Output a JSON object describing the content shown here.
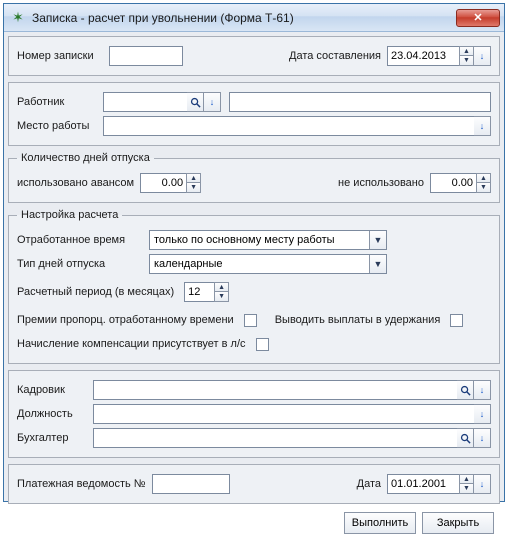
{
  "window": {
    "title": "Записка - расчет при увольнении (Форма Т-61)"
  },
  "top": {
    "note_number_label": "Номер записки",
    "note_number_value": "",
    "date_label": "Дата составления",
    "date_value": "23.04.2013"
  },
  "employee": {
    "worker_label": "Работник",
    "worker_value": "",
    "worker_info": "",
    "workplace_label": "Место работы",
    "workplace_value": ""
  },
  "vacation_days": {
    "legend": "Количество дней отпуска",
    "used_advance_label": "использовано авансом",
    "used_advance_value": "0.00",
    "not_used_label": "не использовано",
    "not_used_value": "0.00"
  },
  "calc": {
    "legend": "Настройка расчета",
    "worked_time_label": "Отработанное время",
    "worked_time_value": "только по основному месту работы",
    "day_type_label": "Тип дней отпуска",
    "day_type_value": "календарные",
    "period_label": "Расчетный период (в месяцах)",
    "period_value": "12",
    "bonus_prop_label": "Премии пропорц. отработанному времени",
    "output_payments_label": "Выводить выплаты в удержания",
    "compensation_label": "Начисление компенсации присутствует в л/с"
  },
  "signers": {
    "hr_label": "Кадровик",
    "hr_value": "",
    "position_label": "Должность",
    "position_value": "",
    "accountant_label": "Бухгалтер",
    "accountant_value": ""
  },
  "bottom": {
    "payroll_label": "Платежная ведомость №",
    "payroll_value": "",
    "date_label": "Дата",
    "date_value": "01.01.2001"
  },
  "buttons": {
    "execute": "Выполнить",
    "close": "Закрыть"
  }
}
